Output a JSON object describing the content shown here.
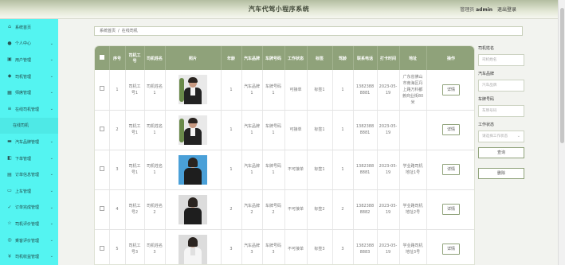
{
  "header": {
    "title": "汽车代驾小程序系统",
    "user_prefix": "管理员",
    "username": "admin",
    "logout": "退出登录"
  },
  "sidebar": {
    "items": [
      {
        "label": "系统首页",
        "icon": "home-icon",
        "chevron": false
      },
      {
        "label": "个人中心",
        "icon": "person-icon",
        "chevron": true
      },
      {
        "label": "用户管理",
        "icon": "users-icon",
        "chevron": true
      },
      {
        "label": "司机管理",
        "icon": "driver-icon",
        "chevron": true
      },
      {
        "label": "师席管理",
        "icon": "grid-icon",
        "chevron": true
      },
      {
        "label": "在线司机管理",
        "icon": "list-icon",
        "chevron": true
      },
      {
        "label": "在线司机",
        "icon": "",
        "chevron": false,
        "sub": true
      },
      {
        "label": "汽车品牌管理",
        "icon": "car-icon",
        "chevron": true
      },
      {
        "label": "下单管理",
        "icon": "cart-icon",
        "chevron": true
      },
      {
        "label": "订单信息管理",
        "icon": "order-icon",
        "chevron": true
      },
      {
        "label": "上车管理",
        "icon": "car-door-icon",
        "chevron": true
      },
      {
        "label": "订单完成管理",
        "icon": "check-icon",
        "chevron": true
      },
      {
        "label": "司机评价管理",
        "icon": "star-icon",
        "chevron": true
      },
      {
        "label": "乘客评价管理",
        "icon": "comment-icon",
        "chevron": true
      },
      {
        "label": "司机收益管理",
        "icon": "money-icon",
        "chevron": true
      }
    ]
  },
  "breadcrumb": {
    "home": "系统首页",
    "separator": "/",
    "current": "在线司机"
  },
  "table": {
    "headers": [
      "",
      "序号",
      "司机工号",
      "司机姓名",
      "照片",
      "年龄",
      "汽车品牌",
      "车牌号码",
      "工作状态",
      "标签",
      "驾龄",
      "联系电话",
      "打卡时间",
      "地址",
      "操作"
    ],
    "rows": [
      {
        "no": "1",
        "id": "司机工号1",
        "name": "司机姓名1",
        "photo": "man-suit",
        "age": "1",
        "brand": "汽车品牌1",
        "plate": "车牌号码1",
        "status": "可接单",
        "tag": "标签1",
        "years": "1",
        "phone": "13823888881",
        "time": "2023-05-19",
        "address": "广东省佛山市南海区丹上路万科都荟商业街80米",
        "action": "详情"
      },
      {
        "no": "2",
        "id": "司机工号1",
        "name": "司机姓名1",
        "photo": "man-suit",
        "age": "1",
        "brand": "汽车品牌1",
        "plate": "车牌号码1",
        "status": "可接单",
        "tag": "标签1",
        "years": "1",
        "phone": "13823888881",
        "time": "2023-05-19",
        "address": "",
        "action": "详情"
      },
      {
        "no": "3",
        "id": "司机工号1",
        "name": "司机姓名1",
        "photo": "woman-blue",
        "age": "1",
        "brand": "汽车品牌1",
        "plate": "车牌号码1",
        "status": "不可接单",
        "tag": "标签1",
        "years": "1",
        "phone": "13823888881",
        "time": "2023-05-19",
        "address": "学业路司机地址1号",
        "action": "详情"
      },
      {
        "no": "4",
        "id": "司机工号2",
        "name": "司机姓名2",
        "photo": "woman-grey",
        "age": "2",
        "brand": "汽车品牌2",
        "plate": "车牌号码2",
        "status": "不可接单",
        "tag": "标签2",
        "years": "2",
        "phone": "13823888882",
        "time": "2023-05-19",
        "address": "学业路司机地址2号",
        "action": "详情"
      },
      {
        "no": "5",
        "id": "司机工号3",
        "name": "司机姓名3",
        "photo": "woman-white",
        "age": "3",
        "brand": "汽车品牌3",
        "plate": "车牌号码3",
        "status": "不可接单",
        "tag": "标签3",
        "years": "3",
        "phone": "13823888883",
        "time": "2023-05-19",
        "address": "学业路司机地址3号",
        "action": "详情"
      }
    ]
  },
  "filters": {
    "name_label": "司机姓名",
    "name_placeholder": "司机姓名",
    "brand_label": "汽车品牌",
    "brand_placeholder": "汽车品牌",
    "plate_label": "车牌号码",
    "plate_placeholder": "车牌号码",
    "status_label": "工作状态",
    "status_placeholder": "请选择工作状态",
    "search_button": "查询",
    "delete_button": "删除"
  },
  "colors": {
    "sidebar": "#54f4f1",
    "accent": "#8fa27a",
    "header_bg": "#b3bea0"
  }
}
